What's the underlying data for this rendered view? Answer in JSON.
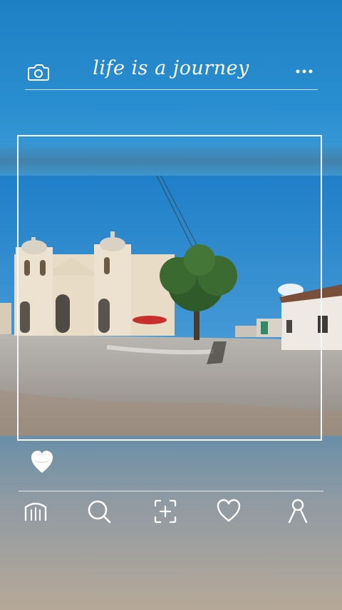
{
  "header": {
    "title": "life is a journey",
    "left_icon": "camera-icon",
    "right_icon": "more-dots-icon"
  },
  "post": {
    "image_description_icon": "photo",
    "like_icon": "heart-icon"
  },
  "bottom_nav": {
    "items": [
      {
        "icon": "home-icon"
      },
      {
        "icon": "search-icon"
      },
      {
        "icon": "add-post-icon"
      },
      {
        "icon": "heart-outline-icon"
      },
      {
        "icon": "profile-icon"
      }
    ]
  },
  "colors": {
    "sky": "#2a8fd0",
    "frame": "#f4f6f8",
    "text": "#ffffff"
  }
}
